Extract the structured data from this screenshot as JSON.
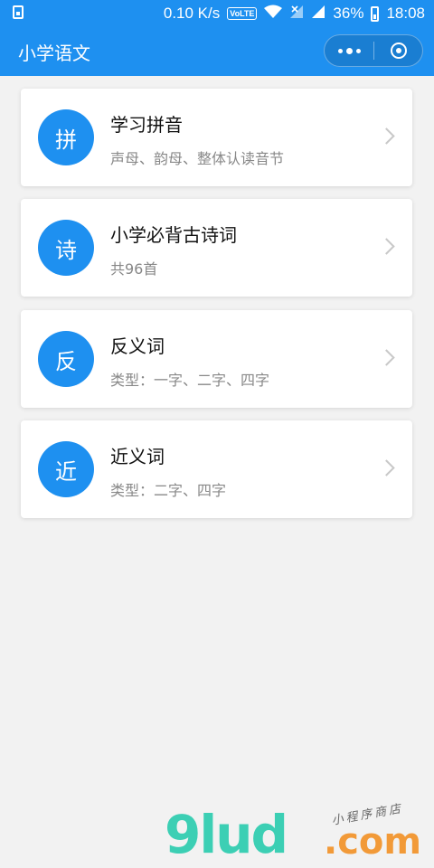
{
  "status_bar": {
    "speed": "0.10 K/s",
    "volte": "VoLTE",
    "battery": "36%",
    "time": "18:08"
  },
  "nav": {
    "title": "小学语文"
  },
  "cards": [
    {
      "icon_char": "拼",
      "title": "学习拼音",
      "subtitle": "声母、韵母、整体认读音节"
    },
    {
      "icon_char": "诗",
      "title": "小学必背古诗词",
      "subtitle": "共96首"
    },
    {
      "icon_char": "反",
      "title": "反义词",
      "subtitle": "类型：一字、二字、四字"
    },
    {
      "icon_char": "近",
      "title": "近义词",
      "subtitle": "类型：二字、四字"
    }
  ],
  "watermark": {
    "main": "9lud",
    "com": ".com",
    "tag": "小程序商店"
  },
  "colors": {
    "primary": "#1e90f0",
    "background": "#f2f2f2"
  }
}
